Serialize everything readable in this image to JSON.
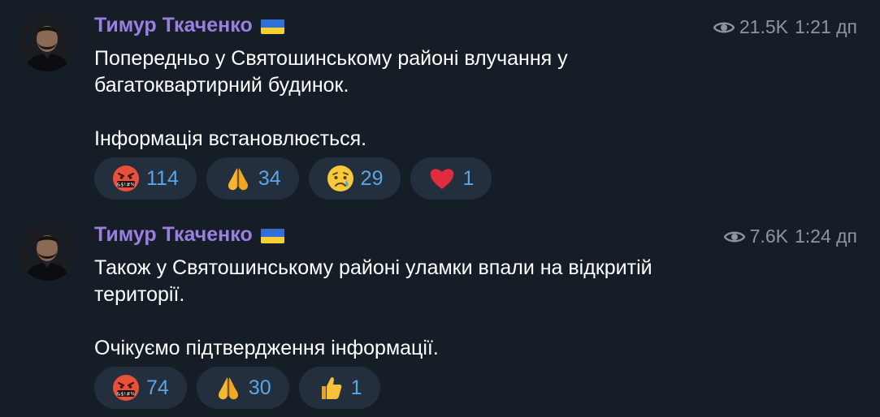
{
  "messages": [
    {
      "sender": "Тимур Ткаченко",
      "views": "21.5K",
      "time": "1:21 дп",
      "paragraphs": [
        "Попередньо у Святошинському районі влучання у багатоквартирний будинок.",
        "Інформація встановлюється."
      ],
      "reactions": [
        {
          "icon": "angry-face-icon",
          "count": "114"
        },
        {
          "icon": "praying-hands-icon",
          "count": "34"
        },
        {
          "icon": "crying-face-icon",
          "count": "29"
        },
        {
          "icon": "red-heart-icon",
          "count": "1"
        }
      ]
    },
    {
      "sender": "Тимур Ткаченко",
      "views": "7.6K",
      "time": "1:24 дп",
      "paragraphs": [
        "Також у Святошинському районі уламки впали на відкритій території.",
        "Очікуємо підтвердження інформації."
      ],
      "reactions": [
        {
          "icon": "angry-face-icon",
          "count": "74"
        },
        {
          "icon": "praying-hands-icon",
          "count": "30"
        },
        {
          "icon": "thumbs-up-icon",
          "count": "1"
        }
      ]
    }
  ],
  "colors": {
    "background": "#151e27",
    "sender_name": "#9b7fe0",
    "meta": "#8a96a3",
    "reaction_bg": "#232f3c",
    "reaction_count": "#5aa5e6",
    "flag_blue": "#2f6fd6",
    "flag_yellow": "#f5d033"
  }
}
